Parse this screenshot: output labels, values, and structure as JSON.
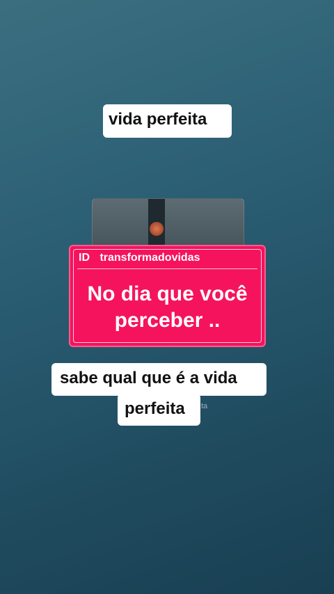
{
  "top_caption": "vida perfeita",
  "card": {
    "id_label": "ID",
    "username": "transformadovidas",
    "message_line1": "No dia que você",
    "message_line2": "perceber ..",
    "background_color": "#f5135e"
  },
  "bottom_caption": {
    "line1": "sabe qual que é a vida",
    "line2": "perfeita"
  },
  "ghost_text": "ta"
}
